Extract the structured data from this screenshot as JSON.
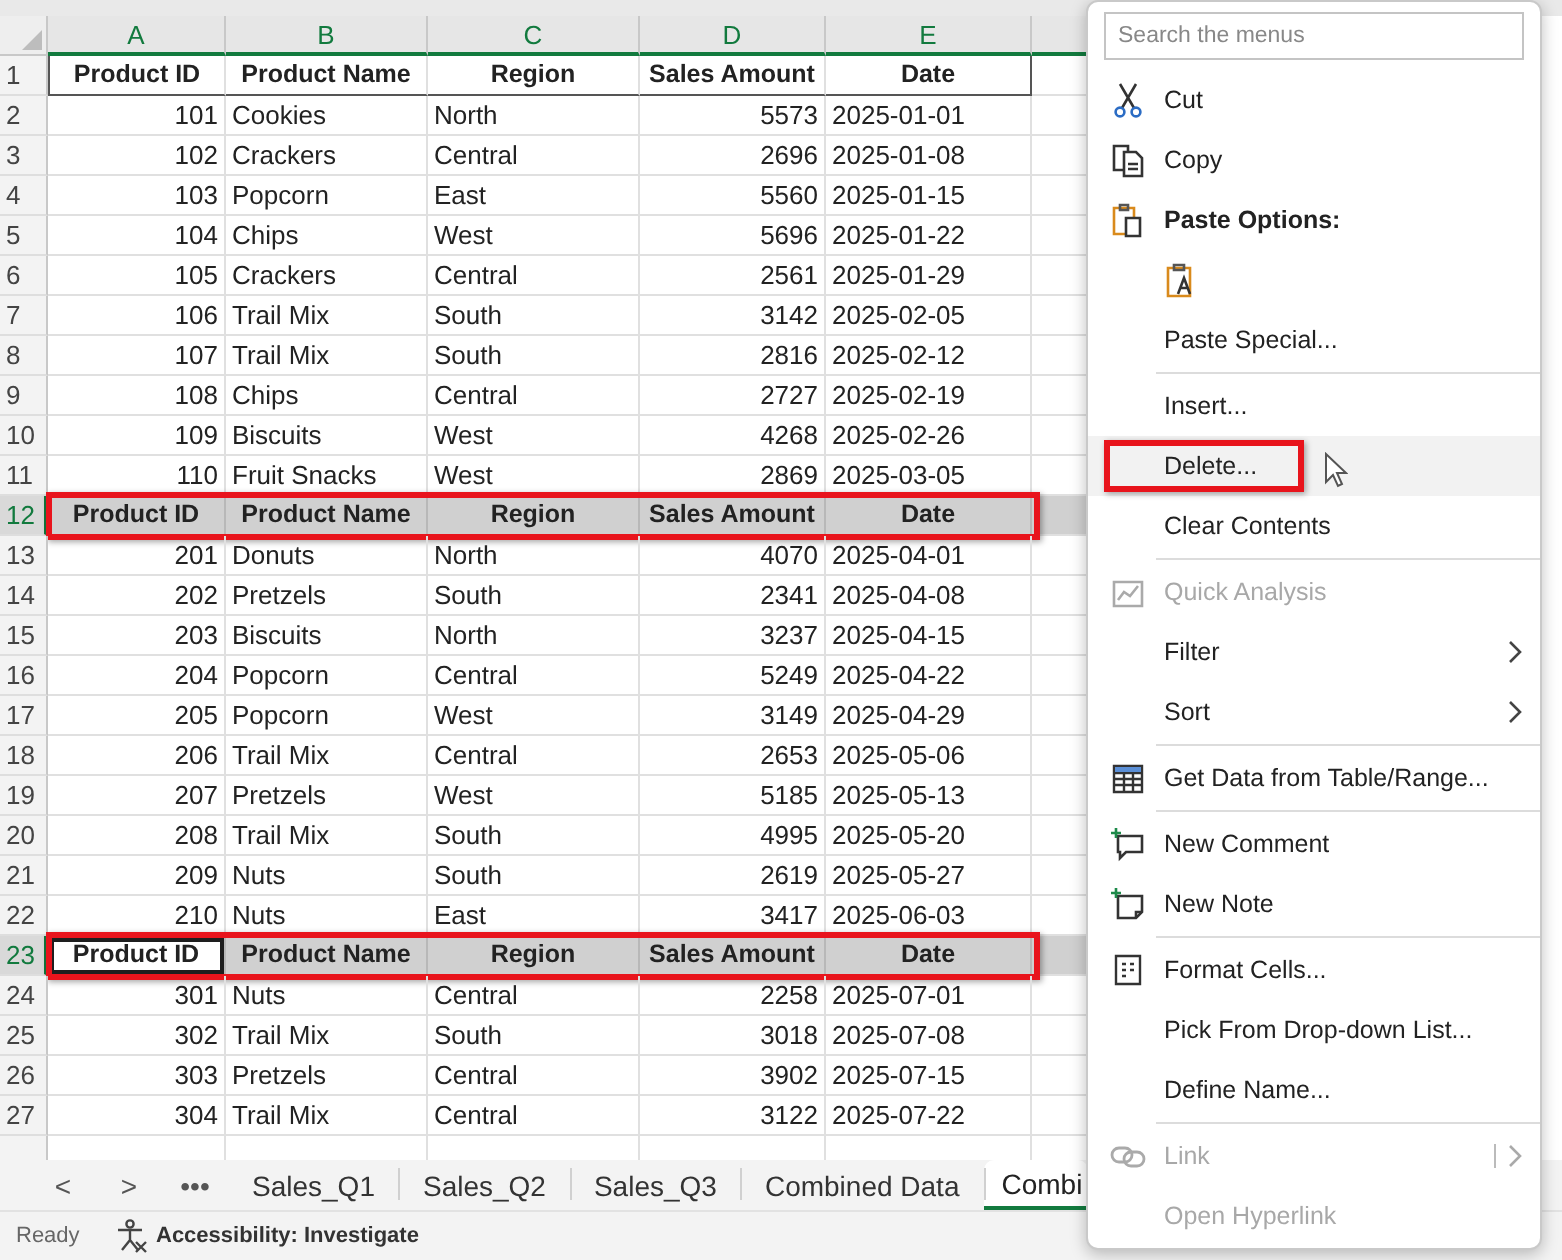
{
  "columns": [
    {
      "letter": "A",
      "kind": "number"
    },
    {
      "letter": "B",
      "kind": "text"
    },
    {
      "letter": "C",
      "kind": "text"
    },
    {
      "letter": "D",
      "kind": "number"
    },
    {
      "letter": "E",
      "kind": "text"
    }
  ],
  "rows": [
    {
      "number": "1",
      "kind": "header",
      "selected": false,
      "highlighted": false,
      "active_first_cell": false,
      "cells": [
        "Product ID",
        "Product Name",
        "Region",
        "Sales Amount",
        "Date"
      ]
    },
    {
      "number": "2",
      "kind": "data",
      "selected": false,
      "highlighted": false,
      "active_first_cell": false,
      "cells": [
        "101",
        "Cookies",
        "North",
        "5573",
        "2025-01-01"
      ]
    },
    {
      "number": "3",
      "kind": "data",
      "selected": false,
      "highlighted": false,
      "active_first_cell": false,
      "cells": [
        "102",
        "Crackers",
        "Central",
        "2696",
        "2025-01-08"
      ]
    },
    {
      "number": "4",
      "kind": "data",
      "selected": false,
      "highlighted": false,
      "active_first_cell": false,
      "cells": [
        "103",
        "Popcorn",
        "East",
        "5560",
        "2025-01-15"
      ]
    },
    {
      "number": "5",
      "kind": "data",
      "selected": false,
      "highlighted": false,
      "active_first_cell": false,
      "cells": [
        "104",
        "Chips",
        "West",
        "5696",
        "2025-01-22"
      ]
    },
    {
      "number": "6",
      "kind": "data",
      "selected": false,
      "highlighted": false,
      "active_first_cell": false,
      "cells": [
        "105",
        "Crackers",
        "Central",
        "2561",
        "2025-01-29"
      ]
    },
    {
      "number": "7",
      "kind": "data",
      "selected": false,
      "highlighted": false,
      "active_first_cell": false,
      "cells": [
        "106",
        "Trail Mix",
        "South",
        "3142",
        "2025-02-05"
      ]
    },
    {
      "number": "8",
      "kind": "data",
      "selected": false,
      "highlighted": false,
      "active_first_cell": false,
      "cells": [
        "107",
        "Trail Mix",
        "South",
        "2816",
        "2025-02-12"
      ]
    },
    {
      "number": "9",
      "kind": "data",
      "selected": false,
      "highlighted": false,
      "active_first_cell": false,
      "cells": [
        "108",
        "Chips",
        "Central",
        "2727",
        "2025-02-19"
      ]
    },
    {
      "number": "10",
      "kind": "data",
      "selected": false,
      "highlighted": false,
      "active_first_cell": false,
      "cells": [
        "109",
        "Biscuits",
        "West",
        "4268",
        "2025-02-26"
      ]
    },
    {
      "number": "11",
      "kind": "data",
      "selected": false,
      "highlighted": false,
      "active_first_cell": false,
      "cells": [
        "110",
        "Fruit Snacks",
        "West",
        "2869",
        "2025-03-05"
      ]
    },
    {
      "number": "12",
      "kind": "header",
      "selected": true,
      "highlighted": true,
      "active_first_cell": false,
      "cells": [
        "Product ID",
        "Product Name",
        "Region",
        "Sales Amount",
        "Date"
      ]
    },
    {
      "number": "13",
      "kind": "data",
      "selected": false,
      "highlighted": false,
      "active_first_cell": false,
      "cells": [
        "201",
        "Donuts",
        "North",
        "4070",
        "2025-04-01"
      ]
    },
    {
      "number": "14",
      "kind": "data",
      "selected": false,
      "highlighted": false,
      "active_first_cell": false,
      "cells": [
        "202",
        "Pretzels",
        "South",
        "2341",
        "2025-04-08"
      ]
    },
    {
      "number": "15",
      "kind": "data",
      "selected": false,
      "highlighted": false,
      "active_first_cell": false,
      "cells": [
        "203",
        "Biscuits",
        "North",
        "3237",
        "2025-04-15"
      ]
    },
    {
      "number": "16",
      "kind": "data",
      "selected": false,
      "highlighted": false,
      "active_first_cell": false,
      "cells": [
        "204",
        "Popcorn",
        "Central",
        "5249",
        "2025-04-22"
      ]
    },
    {
      "number": "17",
      "kind": "data",
      "selected": false,
      "highlighted": false,
      "active_first_cell": false,
      "cells": [
        "205",
        "Popcorn",
        "West",
        "3149",
        "2025-04-29"
      ]
    },
    {
      "number": "18",
      "kind": "data",
      "selected": false,
      "highlighted": false,
      "active_first_cell": false,
      "cells": [
        "206",
        "Trail Mix",
        "Central",
        "2653",
        "2025-05-06"
      ]
    },
    {
      "number": "19",
      "kind": "data",
      "selected": false,
      "highlighted": false,
      "active_first_cell": false,
      "cells": [
        "207",
        "Pretzels",
        "West",
        "5185",
        "2025-05-13"
      ]
    },
    {
      "number": "20",
      "kind": "data",
      "selected": false,
      "highlighted": false,
      "active_first_cell": false,
      "cells": [
        "208",
        "Trail Mix",
        "South",
        "4995",
        "2025-05-20"
      ]
    },
    {
      "number": "21",
      "kind": "data",
      "selected": false,
      "highlighted": false,
      "active_first_cell": false,
      "cells": [
        "209",
        "Nuts",
        "South",
        "2619",
        "2025-05-27"
      ]
    },
    {
      "number": "22",
      "kind": "data",
      "selected": false,
      "highlighted": false,
      "active_first_cell": false,
      "cells": [
        "210",
        "Nuts",
        "East",
        "3417",
        "2025-06-03"
      ]
    },
    {
      "number": "23",
      "kind": "header",
      "selected": true,
      "highlighted": true,
      "active_first_cell": true,
      "cells": [
        "Product ID",
        "Product Name",
        "Region",
        "Sales Amount",
        "Date"
      ]
    },
    {
      "number": "24",
      "kind": "data",
      "selected": false,
      "highlighted": false,
      "active_first_cell": false,
      "cells": [
        "301",
        "Nuts",
        "Central",
        "2258",
        "2025-07-01"
      ]
    },
    {
      "number": "25",
      "kind": "data",
      "selected": false,
      "highlighted": false,
      "active_first_cell": false,
      "cells": [
        "302",
        "Trail Mix",
        "South",
        "3018",
        "2025-07-08"
      ]
    },
    {
      "number": "26",
      "kind": "data",
      "selected": false,
      "highlighted": false,
      "active_first_cell": false,
      "cells": [
        "303",
        "Pretzels",
        "Central",
        "3902",
        "2025-07-15"
      ]
    },
    {
      "number": "27",
      "kind": "data",
      "selected": false,
      "highlighted": false,
      "active_first_cell": false,
      "cells": [
        "304",
        "Trail Mix",
        "Central",
        "3122",
        "2025-07-22"
      ]
    }
  ],
  "context_menu": {
    "search": {
      "placeholder": "Search the menus"
    },
    "items": [
      {
        "kind": "item",
        "label": "Cut",
        "disabled": false,
        "submenu": false,
        "hovered": false,
        "highlighted": false,
        "separator_after": false
      },
      {
        "kind": "item",
        "label": "Copy",
        "disabled": false,
        "submenu": false,
        "hovered": false,
        "highlighted": false,
        "separator_after": false
      },
      {
        "kind": "heading",
        "label": "Paste Options:",
        "disabled": false,
        "submenu": false,
        "hovered": false,
        "highlighted": false,
        "separator_after": false
      },
      {
        "kind": "paste-option",
        "disabled": false,
        "submenu": false,
        "hovered": false,
        "highlighted": false,
        "separator_after": false
      },
      {
        "kind": "item",
        "label": "Paste Special...",
        "disabled": false,
        "submenu": false,
        "hovered": false,
        "highlighted": false,
        "separator_after": true
      },
      {
        "kind": "item",
        "label": "Insert...",
        "disabled": false,
        "submenu": false,
        "hovered": false,
        "highlighted": false,
        "separator_after": false
      },
      {
        "kind": "item",
        "label": "Delete...",
        "disabled": false,
        "submenu": false,
        "hovered": true,
        "highlighted": true,
        "separator_after": false
      },
      {
        "kind": "item",
        "label": "Clear Contents",
        "disabled": false,
        "submenu": false,
        "hovered": false,
        "highlighted": false,
        "separator_after": true
      },
      {
        "kind": "item",
        "label": "Quick Analysis",
        "disabled": true,
        "submenu": false,
        "hovered": false,
        "highlighted": false,
        "separator_after": false
      },
      {
        "kind": "item",
        "label": "Filter",
        "disabled": false,
        "submenu": true,
        "hovered": false,
        "highlighted": false,
        "separator_after": false
      },
      {
        "kind": "item",
        "label": "Sort",
        "disabled": false,
        "submenu": true,
        "hovered": false,
        "highlighted": false,
        "separator_after": true
      },
      {
        "kind": "item",
        "label": "Get Data from Table/Range...",
        "disabled": false,
        "submenu": false,
        "hovered": false,
        "highlighted": false,
        "separator_after": true
      },
      {
        "kind": "item",
        "label": "New Comment",
        "disabled": false,
        "submenu": false,
        "hovered": false,
        "highlighted": false,
        "separator_after": false
      },
      {
        "kind": "item",
        "label": "New Note",
        "disabled": false,
        "submenu": false,
        "hovered": false,
        "highlighted": false,
        "separator_after": true
      },
      {
        "kind": "item",
        "label": "Format Cells...",
        "disabled": false,
        "submenu": false,
        "hovered": false,
        "highlighted": false,
        "separator_after": false
      },
      {
        "kind": "item",
        "label": "Pick From Drop-down List...",
        "disabled": false,
        "submenu": false,
        "hovered": false,
        "highlighted": false,
        "separator_after": false
      },
      {
        "kind": "item",
        "label": "Define Name...",
        "disabled": false,
        "submenu": false,
        "hovered": false,
        "highlighted": false,
        "separator_after": true
      },
      {
        "kind": "item",
        "label": "Link",
        "disabled": true,
        "submenu": true,
        "hovered": false,
        "highlighted": false,
        "separator_after": false
      },
      {
        "kind": "item",
        "label": "Open Hyperlink",
        "disabled": true,
        "submenu": false,
        "hovered": false,
        "highlighted": false,
        "separator_after": false
      }
    ]
  },
  "sheet_tabs": {
    "navigation": [
      "<",
      ">",
      "•••"
    ],
    "tabs": [
      {
        "label": "Sales_Q1",
        "selected": false
      },
      {
        "label": "Sales_Q2",
        "selected": false
      },
      {
        "label": "Sales_Q3",
        "selected": false
      },
      {
        "label": "Combined Data",
        "selected": false
      },
      {
        "label": "Combi",
        "selected": true
      }
    ]
  },
  "status_bar": {
    "mode": "Ready",
    "accessibility": "Accessibility: Investigate"
  }
}
